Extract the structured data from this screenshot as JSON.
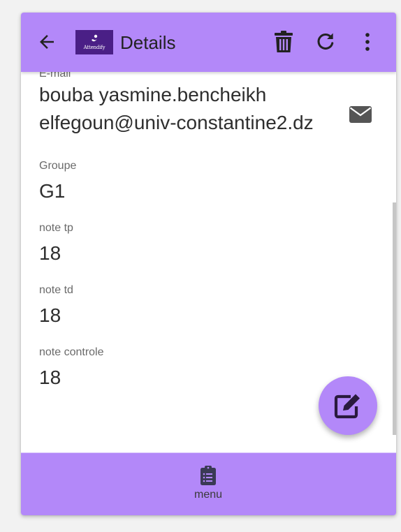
{
  "header": {
    "title": "Details",
    "logo_text": "Attendify",
    "back_icon": "arrow-left-icon",
    "actions": [
      {
        "name": "delete",
        "icon": "trash-icon"
      },
      {
        "name": "refresh",
        "icon": "refresh-icon"
      },
      {
        "name": "more",
        "icon": "more-vert-icon"
      }
    ]
  },
  "fields": {
    "email": {
      "label": "E-mail",
      "value_line1": "bouba yasmine.bencheikh",
      "value_line2": "elfegoun@univ-constantine2.dz",
      "action_icon": "mail-icon"
    },
    "group": {
      "label": "Groupe",
      "value": "G1"
    },
    "note_tp": {
      "label": "note tp",
      "value": "18"
    },
    "note_td": {
      "label": "note td",
      "value": "18"
    },
    "note_controle": {
      "label": "note controle",
      "value": "18"
    }
  },
  "fab": {
    "icon": "edit-icon"
  },
  "bottom_nav": {
    "items": [
      {
        "label": "menu",
        "icon": "clipboard-list-icon"
      }
    ]
  },
  "colors": {
    "accent": "#b388f9",
    "logo_bg": "#4a1f86",
    "icon": "#222222",
    "text": "#2e2e2e",
    "label": "#6a6a6a"
  }
}
